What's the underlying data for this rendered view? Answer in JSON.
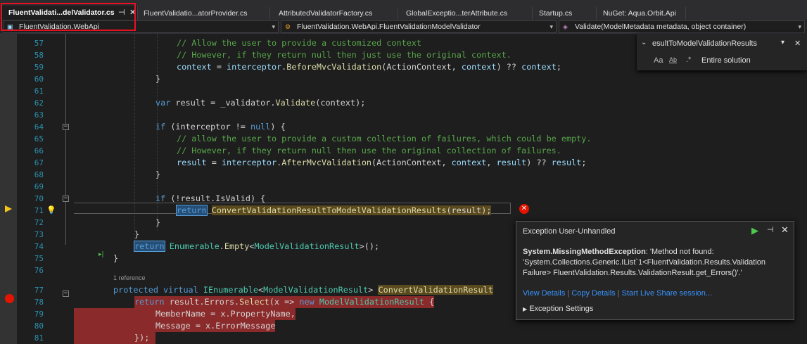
{
  "tabs": [
    {
      "label": "FluentValidati...delValidator.cs"
    },
    {
      "label": "FluentValidatio...atorProvider.cs"
    },
    {
      "label": "AttributedValidatorFactory.cs"
    },
    {
      "label": "GlobalExceptio...terAttribute.cs"
    },
    {
      "label": "Startup.cs"
    },
    {
      "label": "NuGet: Aqua.Orbit.Api"
    }
  ],
  "navbar": {
    "project": "FluentValidation.WebApi",
    "type": "FluentValidation.WebApi.FluentValidationModelValidator",
    "member": "Validate(ModelMetadata metadata, object container)"
  },
  "line_numbers": [
    "57",
    "58",
    "59",
    "60",
    "61",
    "62",
    "63",
    "64",
    "65",
    "66",
    "67",
    "68",
    "69",
    "70",
    "71",
    "72",
    "73",
    "74",
    "75",
    "76",
    "77",
    "78",
    "79",
    "80",
    "81"
  ],
  "code": {
    "l57": "// Allow the user to provide a customized context",
    "l58": "// However, if they return null then just use the original context.",
    "l59_a": "context",
    "l59_b": " = ",
    "l59_c": "interceptor",
    "l59_d": ".",
    "l59_e": "BeforeMvcValidation",
    "l59_f": "(ActionContext, ",
    "l59_g": "context",
    "l59_h": ") ?? ",
    "l59_i": "context",
    "l59_j": ";",
    "l60": "}",
    "l62_a": "var",
    "l62_b": " result = _validator.",
    "l62_c": "Validate",
    "l62_d": "(context);",
    "l64_a": "if",
    "l64_b": " (interceptor != ",
    "l64_c": "null",
    "l64_d": ") {",
    "l65": "// allow the user to provide a custom collection of failures, which could be empty.",
    "l66": "// However, if they return null then use the original collection of failures.",
    "l67_a": "result",
    "l67_b": " = ",
    "l67_c": "interceptor",
    "l67_d": ".",
    "l67_e": "AfterMvcValidation",
    "l67_f": "(ActionContext, ",
    "l67_g": "context",
    "l67_h": ", ",
    "l67_i": "result",
    "l67_j": ") ?? ",
    "l67_k": "result",
    "l67_l": ";",
    "l68": "}",
    "l70_a": "if",
    "l70_b": " (!result.IsValid) {",
    "l71_a": "return",
    "l71_b": " ",
    "l71_c": "ConvertValidationResultToModelValidationResults",
    "l71_d": "(result);",
    "l72": "}",
    "l73": "}",
    "l74_a": "return",
    "l74_b": " ",
    "l74_c": "Enumerable",
    "l74_d": ".",
    "l74_e": "Empty",
    "l74_f": "<",
    "l74_g": "ModelValidationResult",
    "l74_h": ">();",
    "l75": "}",
    "ref": "1 reference",
    "l77_a": "protected",
    "l77_b": " ",
    "l77_c": "virtual",
    "l77_d": " ",
    "l77_e": "IEnumerable",
    "l77_f": "<",
    "l77_g": "ModelValidationResult",
    "l77_h": "> ",
    "l77_i": "ConvertValidationResult",
    "l78_a": "return",
    "l78_b": " result.Errors.",
    "l78_c": "Select",
    "l78_d": "(x => ",
    "l78_e": "new",
    "l78_f": " ",
    "l78_g": "ModelValidationResult",
    "l78_h": " {",
    "l79": "MemberName = x.PropertyName,",
    "l80": "Message = x.ErrorMessage",
    "l81": "});"
  },
  "find": {
    "text": "esultToModelValidationResults",
    "scope": "Entire solution",
    "match_case": "Aa",
    "whole_word": "Ab"
  },
  "exception": {
    "title": "Exception User-Unhandled",
    "type": "System.MissingMethodException",
    "message": ": 'Method not found: 'System.Collections.Generic.IList`1<FluentValidation.Results.Validation Failure> FluentValidation.Results.ValidationResult.get_Errors()'.'",
    "view_details": "View Details",
    "copy_details": "Copy Details",
    "live_share": "Start Live Share session...",
    "settings": "Exception Settings"
  }
}
